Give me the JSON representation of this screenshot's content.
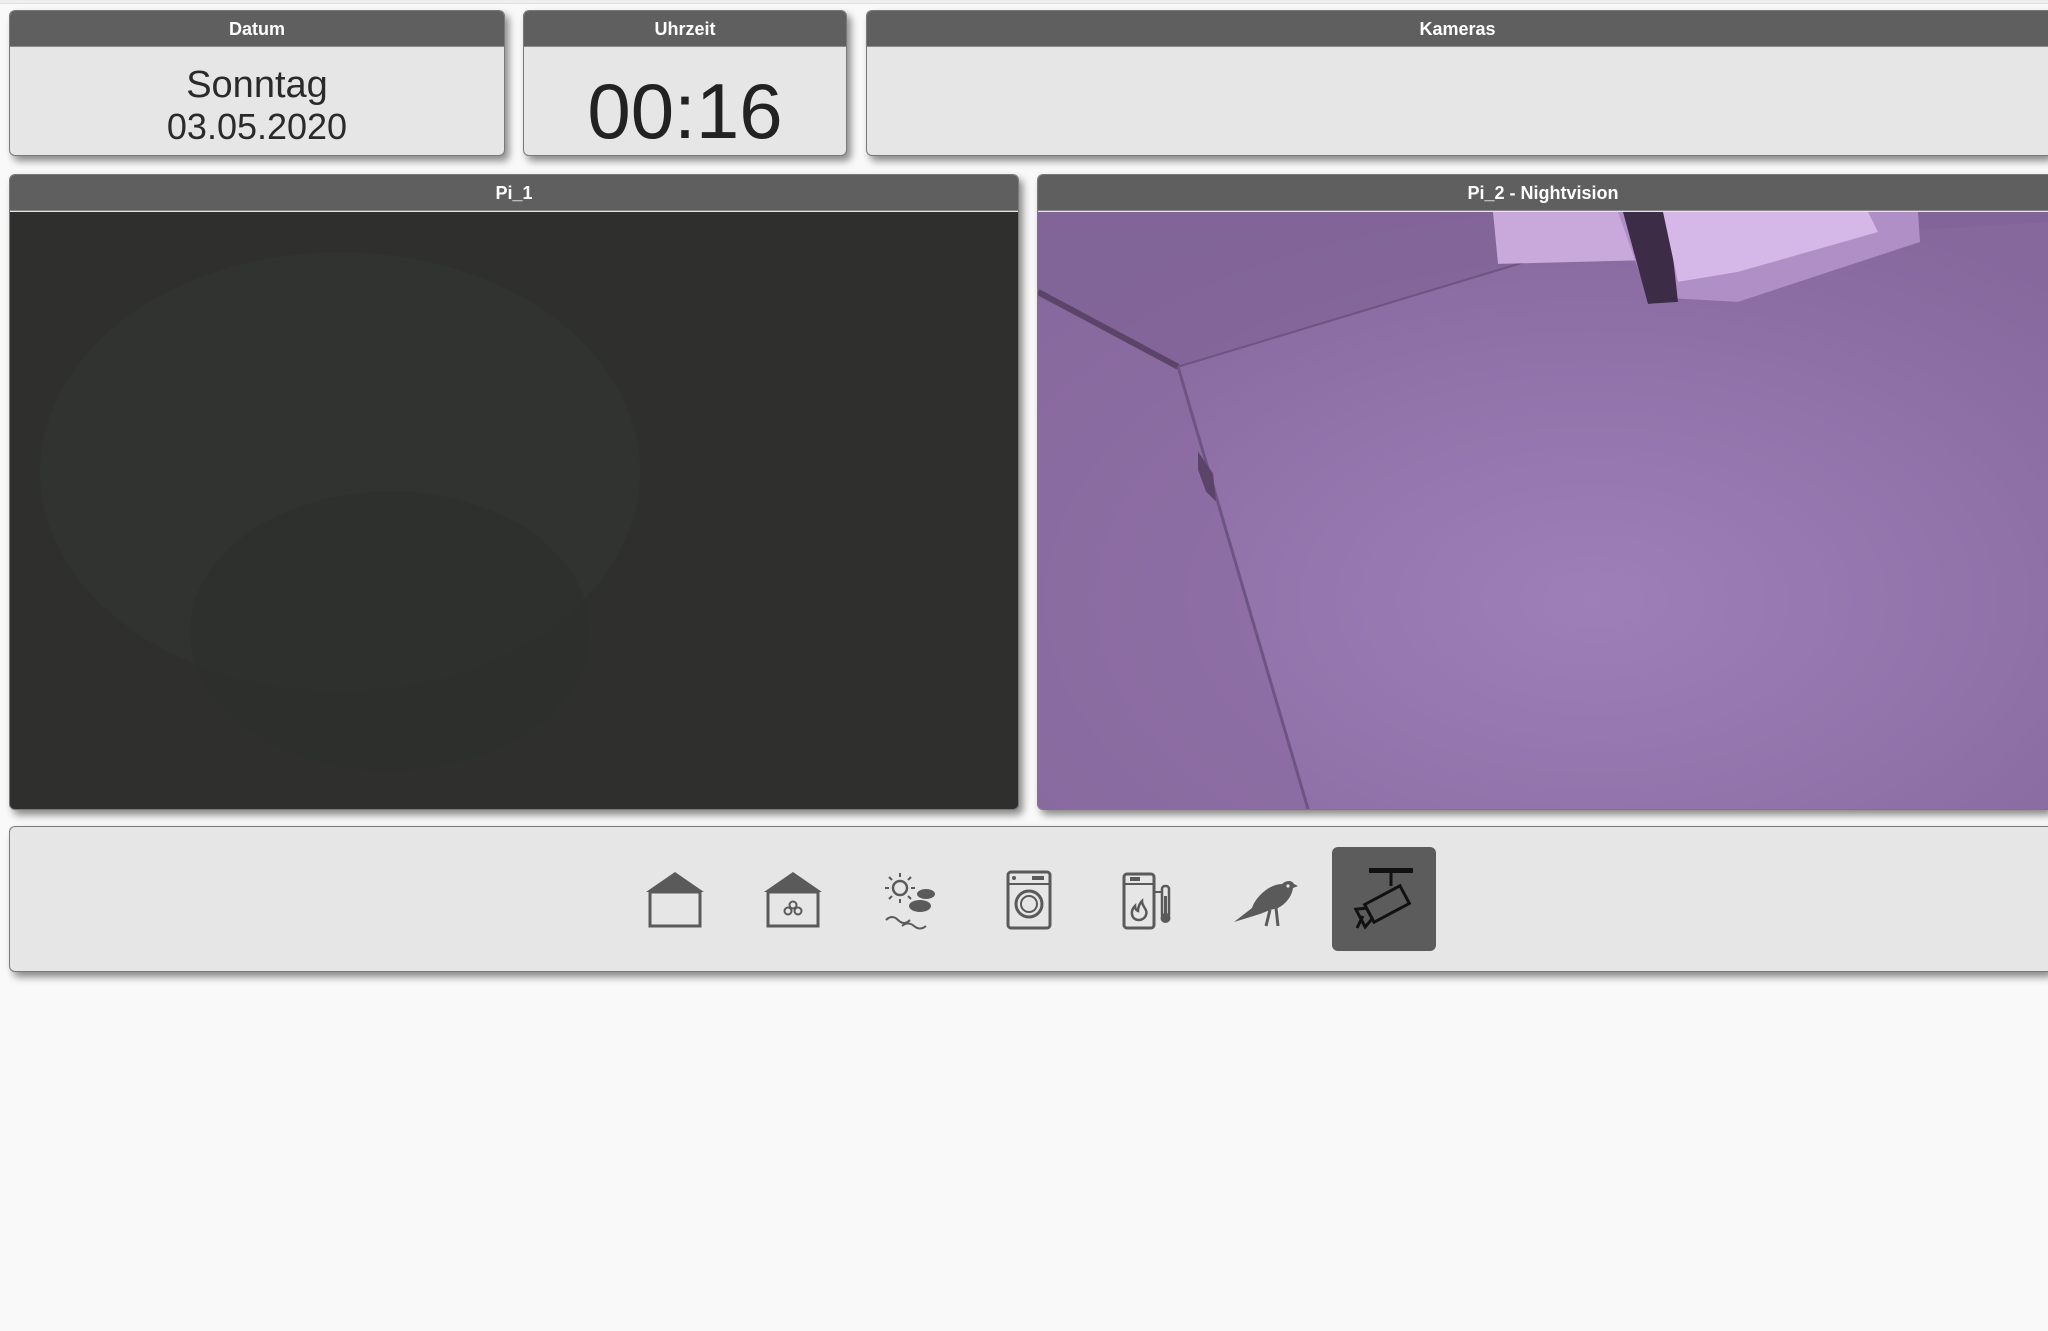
{
  "widgets": {
    "datum": {
      "title": "Datum",
      "day": "Sonntag",
      "date": "03.05.2020"
    },
    "uhrzeit": {
      "title": "Uhrzeit",
      "time": "00:16"
    },
    "kameras": {
      "title": "Kameras"
    }
  },
  "cameras": [
    {
      "title": "Pi_1"
    },
    {
      "title": "Pi_2 - Nightvision"
    }
  ],
  "navigation": {
    "items": [
      {
        "icon": "house-icon",
        "active": false
      },
      {
        "icon": "house-fan-icon",
        "active": false
      },
      {
        "icon": "weather-sun-clouds-icon",
        "active": false
      },
      {
        "icon": "washing-machine-icon",
        "active": false
      },
      {
        "icon": "boiler-thermometer-icon",
        "active": false
      },
      {
        "icon": "bird-icon",
        "active": false
      },
      {
        "icon": "security-camera-icon",
        "active": true
      }
    ]
  },
  "colors": {
    "header": "#5f5f5f",
    "panel": "#e6e6e6",
    "icon": "#5a5a5a",
    "active_nav": "#5c5c5c",
    "nightvision": "#8d6ea6"
  }
}
